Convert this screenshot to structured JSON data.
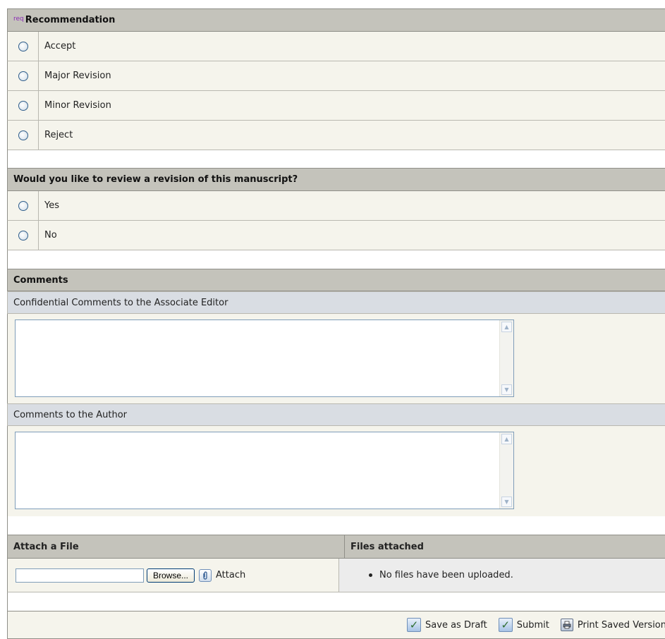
{
  "recommendation": {
    "req_tag": "req",
    "title": "Recommendation",
    "options": [
      "Accept",
      "Major Revision",
      "Minor Revision",
      "Reject"
    ]
  },
  "review_revision": {
    "title": "Would you like to review a revision of this manuscript?",
    "options": [
      "Yes",
      "No"
    ]
  },
  "comments": {
    "title": "Comments",
    "confidential_label": "Confidential Comments to the Associate Editor",
    "confidential_value": "",
    "author_label": "Comments to the Author",
    "author_value": ""
  },
  "attach": {
    "title": "Attach a File",
    "files_title": "Files attached",
    "browse_label": "Browse...",
    "attach_label": "Attach",
    "file_value": "",
    "no_files_text": "No files have been uploaded."
  },
  "footer": {
    "save_draft": "Save as Draft",
    "submit": "Submit",
    "print": "Print Saved Version"
  },
  "icons": {
    "check": "checkmark-icon",
    "paperclip": "paperclip-icon",
    "print": "printer-icon"
  }
}
